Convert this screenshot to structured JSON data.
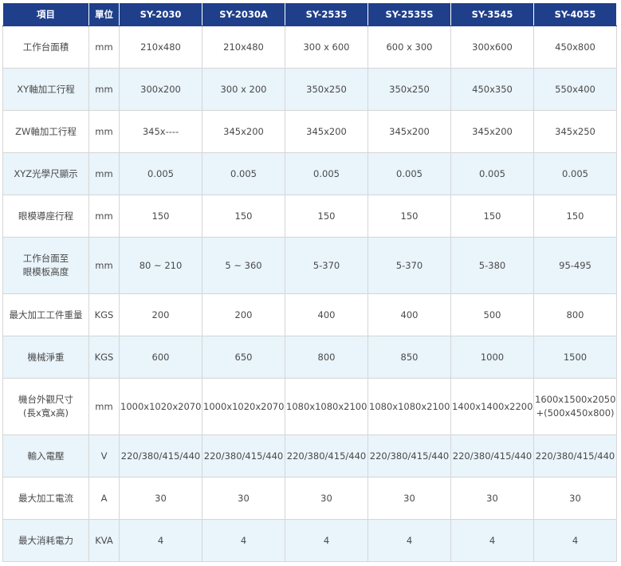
{
  "headers": [
    "項目",
    "單位",
    "SY-2030",
    "SY-2030A",
    "SY-2535",
    "SY-2535S",
    "SY-3545",
    "SY-4055"
  ],
  "rows": [
    {
      "label": [
        "工作台面積"
      ],
      "unit": "mm",
      "values": [
        "210x480",
        "210x480",
        "300 x 600",
        "600 x 300",
        "300x600",
        "450x800"
      ]
    },
    {
      "label": [
        "XY軸加工行程"
      ],
      "unit": "mm",
      "values": [
        "300x200",
        "300 x 200",
        "350x250",
        "350x250",
        "450x350",
        "550x400"
      ]
    },
    {
      "label": [
        "ZW軸加工行程"
      ],
      "unit": "mm",
      "values": [
        "345x----",
        "345x200",
        "345x200",
        "345x200",
        "345x200",
        "345x250"
      ]
    },
    {
      "label": [
        "XYZ光學尺顯示"
      ],
      "unit": "mm",
      "values": [
        "0.005",
        "0.005",
        "0.005",
        "0.005",
        "0.005",
        "0.005"
      ]
    },
    {
      "label": [
        "眼模導座行程"
      ],
      "unit": "mm",
      "values": [
        "150",
        "150",
        "150",
        "150",
        "150",
        "150"
      ]
    },
    {
      "label": [
        "工作台面至",
        "眼模板高度"
      ],
      "unit": "mm",
      "values": [
        "80 ~ 210",
        "5 ~ 360",
        "5-370",
        "5-370",
        "5-380",
        "95-495"
      ]
    },
    {
      "label": [
        "最大加工工件重量"
      ],
      "unit": "KGS",
      "values": [
        "200",
        "200",
        "400",
        "400",
        "500",
        "800"
      ]
    },
    {
      "label": [
        "機械淨重"
      ],
      "unit": "KGS",
      "values": [
        "600",
        "650",
        "800",
        "850",
        "1000",
        "1500"
      ]
    },
    {
      "label": [
        "機台外觀尺寸",
        "(長x寬x高)"
      ],
      "unit": "mm",
      "values": [
        "1000x1020x2070",
        "1000x1020x2070",
        "1080x1080x2100",
        "1080x1080x2100",
        "1400x1400x2200",
        "1600x1500x2050\n+(500x450x800)"
      ]
    },
    {
      "label": [
        "輸入電壓"
      ],
      "unit": "V",
      "values": [
        "220/380/415/440",
        "220/380/415/440",
        "220/380/415/440",
        "220/380/415/440",
        "220/380/415/440",
        "220/380/415/440"
      ]
    },
    {
      "label": [
        "最大加工電流"
      ],
      "unit": "A",
      "values": [
        "30",
        "30",
        "30",
        "30",
        "30",
        "30"
      ]
    },
    {
      "label": [
        "最大消耗電力"
      ],
      "unit": "KVA",
      "values": [
        "4",
        "4",
        "4",
        "4",
        "4",
        "4"
      ]
    }
  ]
}
